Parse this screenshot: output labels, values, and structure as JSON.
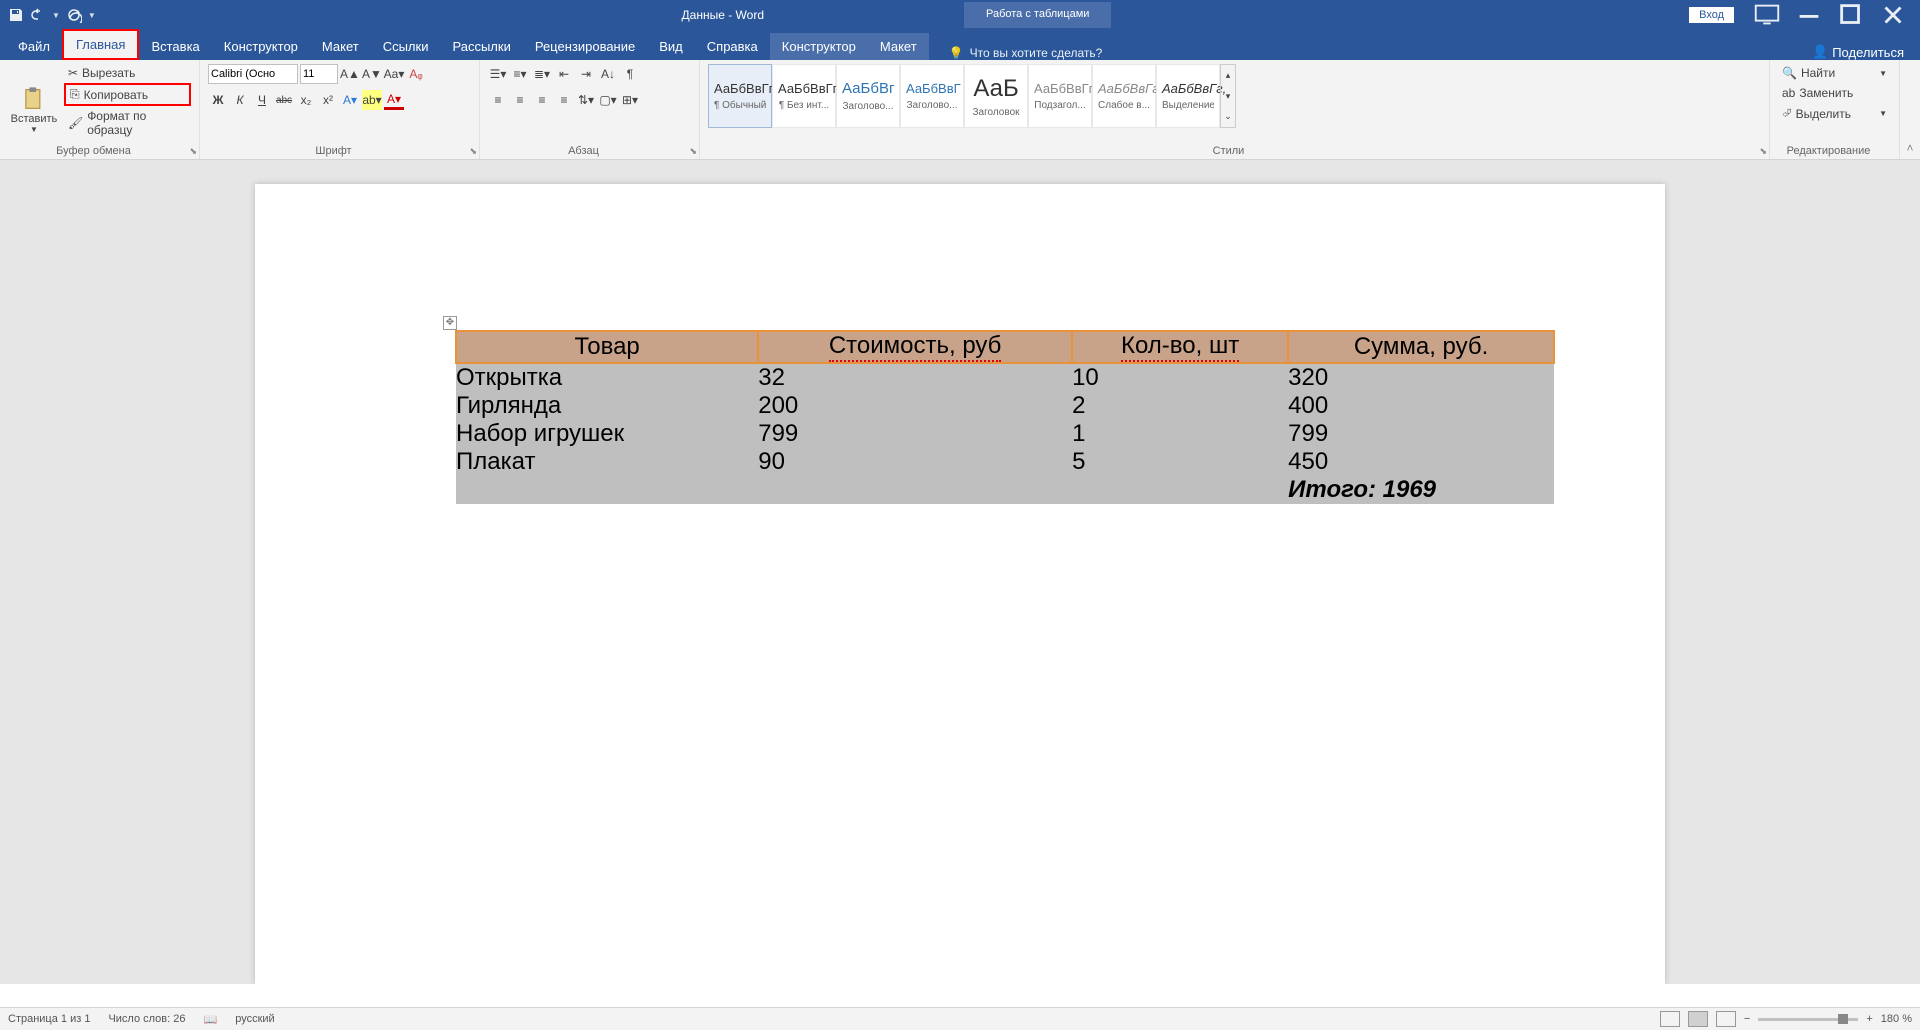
{
  "title_bar": {
    "doc": "Данные - Word",
    "context": "Работа с таблицами",
    "login": "Вход"
  },
  "tabs": [
    "Файл",
    "Главная",
    "Вставка",
    "Конструктор",
    "Макет",
    "Ссылки",
    "Рассылки",
    "Рецензирование",
    "Вид",
    "Справка",
    "Конструктор",
    "Макет"
  ],
  "active_tab": 1,
  "tellme": "Что вы хотите сделать?",
  "share": "Поделиться",
  "clipboard": {
    "paste": "Вставить",
    "cut": "Вырезать",
    "copy": "Копировать",
    "fmt": "Формат по образцу",
    "title": "Буфер обмена"
  },
  "font": {
    "name": "Calibri (Осно",
    "size": "11",
    "title": "Шрифт",
    "bold": "Ж",
    "italic": "К",
    "underline": "Ч",
    "strike": "abc",
    "sub": "x₂",
    "sup": "x²"
  },
  "para": {
    "title": "Абзац"
  },
  "styles": {
    "title": "Стили",
    "items": [
      {
        "p": "АаБбВвГг,",
        "n": "¶ Обычный"
      },
      {
        "p": "АаБбВвГг,",
        "n": "¶ Без инт..."
      },
      {
        "p": "АаБбВг",
        "n": "Заголово..."
      },
      {
        "p": "АаБбВвГ",
        "n": "Заголово..."
      },
      {
        "p": "АаБ",
        "n": "Заголовок"
      },
      {
        "p": "АаБбВвГг,",
        "n": "Подзагол..."
      },
      {
        "p": "АаБбВвГг,",
        "n": "Слабое в..."
      },
      {
        "p": "АаБбВвГг,",
        "n": "Выделение"
      }
    ]
  },
  "editing": {
    "find": "Найти",
    "replace": "Заменить",
    "select": "Выделить",
    "title": "Редактирование"
  },
  "table": {
    "headers": [
      "Товар",
      "Стоимость, руб",
      "Кол-во, шт",
      "Сумма, руб."
    ],
    "rows": [
      [
        "Открытка",
        "32",
        "10",
        "320"
      ],
      [
        "Гирлянда",
        "200",
        "2",
        "400"
      ],
      [
        "Набор игрушек",
        "799",
        "1",
        "799"
      ],
      [
        "Плакат",
        "90",
        "5",
        "450"
      ]
    ],
    "total": "Итого: 1969"
  },
  "status": {
    "page": "Страница 1 из 1",
    "words": "Число слов: 26",
    "lang": "русский",
    "zoom": "180 %"
  }
}
